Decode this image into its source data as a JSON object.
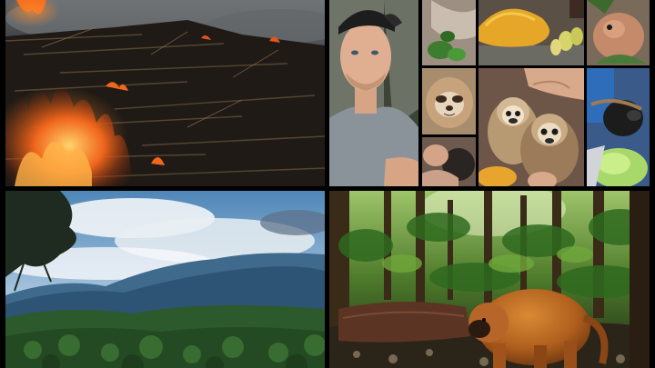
{
  "collage": {
    "panels": [
      {
        "id": "fire",
        "subject": "burning-forest-clearing"
      },
      {
        "id": "mosaic",
        "subject": "wildlife-rescue-mosaic"
      },
      {
        "id": "mountain",
        "subject": "rainforest-mountain-landscape"
      },
      {
        "id": "jungle",
        "subject": "howler-monkey-on-jungle-floor"
      }
    ],
    "colors": {
      "background": "#000000",
      "fire": "#e8541a",
      "smoke": "#6b6f73",
      "sky": "#8fb6d6",
      "forest": "#2f5a2a",
      "monkey_fur": "#b5621f"
    }
  }
}
